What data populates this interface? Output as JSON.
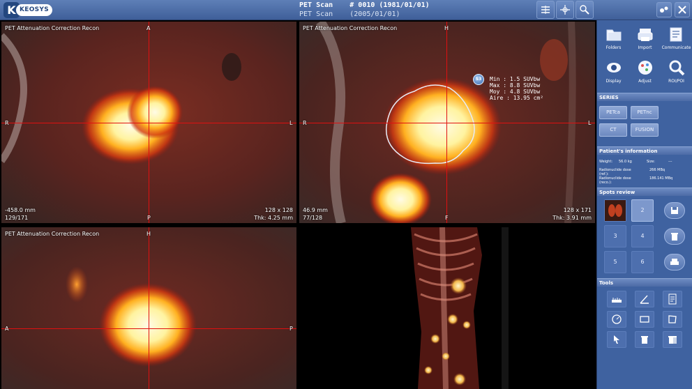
{
  "app": {
    "brand_letter": "K",
    "brand_word": "KEOSYS"
  },
  "study": {
    "line1_label": "PET Scan",
    "line1_value": "# 0010 (1981/01/01)",
    "line2_label": "PET Scan",
    "line2_value": "(2005/01/01)"
  },
  "toolbar": {
    "icons": [
      "layout-icon",
      "crosshair-icon",
      "pan-zoom-icon"
    ],
    "settings_icon": "settings-icon",
    "close_icon": "close-icon"
  },
  "viewports": {
    "v1": {
      "title": "PET Attenuation Correction Recon",
      "top": "A",
      "bottom": "P",
      "left": "R",
      "right": "L",
      "position": "-458.0 mm",
      "slice": "129/171",
      "matrix": "128 x 128",
      "thickness": "Thk: 4.25 mm"
    },
    "v2": {
      "title": "PET Attenuation Correction Recon",
      "top": "H",
      "bottom": "F",
      "left": "R",
      "right": "L",
      "position": "46.9 mm",
      "slice": "77/128",
      "matrix": "128 x 171",
      "thickness": "Thk: 3.91 mm",
      "roi_id": "S3",
      "roi_min": "Min : 1.5 SUVbw",
      "roi_max": "Max : 8.8 SUVbw",
      "roi_moy": "Moy : 4.8 SUVbw",
      "roi_aire": "Aire : 13.95 cm²"
    },
    "v3": {
      "title": "PET Attenuation Correction Recon",
      "top": "H",
      "left": "A",
      "right": "P"
    }
  },
  "panel": {
    "actions": [
      {
        "label": "Folders",
        "icon": "folders-icon"
      },
      {
        "label": "Import",
        "icon": "import-icon"
      },
      {
        "label": "Communicate",
        "icon": "communicate-icon"
      },
      {
        "label": "Display",
        "icon": "display-icon"
      },
      {
        "label": "Adjust",
        "icon": "adjust-icon"
      },
      {
        "label": "ROI/POI",
        "icon": "roi-poi-icon"
      }
    ],
    "series_header": "SERIES",
    "series": [
      "PETca",
      "PETnc",
      "CT",
      "FUSION"
    ],
    "patient_header": "Patient's information",
    "patient": {
      "weight_label": "Weight:",
      "weight_value": "56.0 kg",
      "size_label": "Size:",
      "size_value": "---",
      "dose_ref_label": "Radionuclide dose (ref.):",
      "dose_ref_value": "266 MBq",
      "dose_reco_label": "Radionuclide dose (reco.):",
      "dose_reco_value": "186.141 MBq"
    },
    "spots_header": "Spots review",
    "spots": [
      "2",
      "3",
      "4",
      "5",
      "6"
    ],
    "tools_header": "Tools"
  },
  "colors": {
    "accent": "#3f62a0",
    "crosshair": "#e01010",
    "active_border": "#d8a23a"
  }
}
